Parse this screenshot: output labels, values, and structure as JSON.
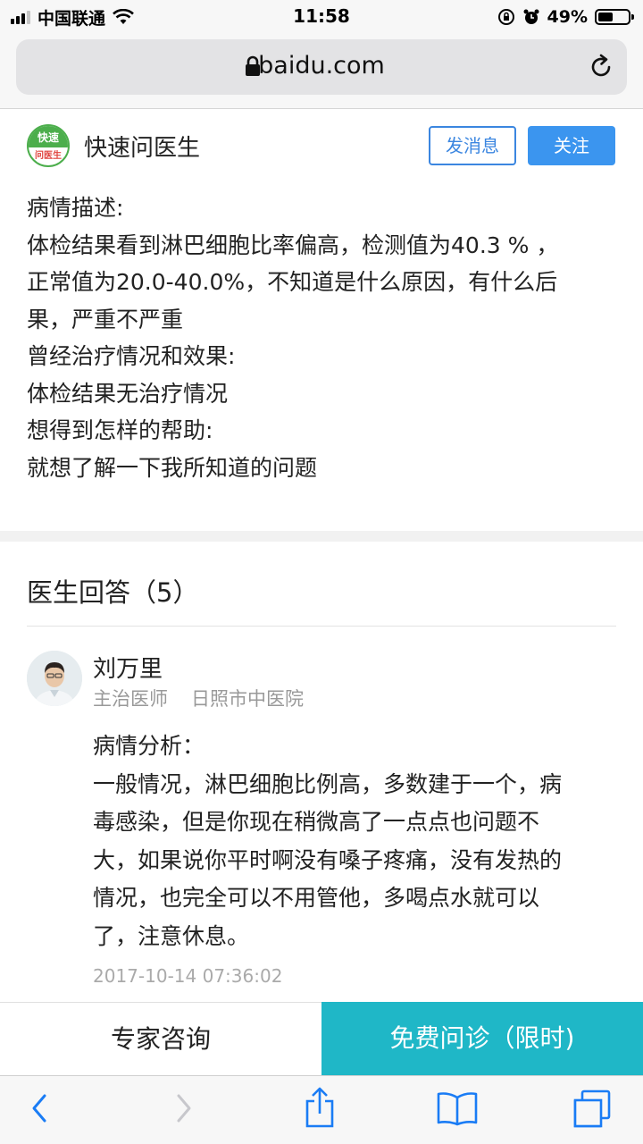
{
  "status_bar": {
    "carrier": "中国联通",
    "time": "11:58",
    "battery_text": "49%",
    "battery_level": 0.49
  },
  "browser": {
    "url": "baidu.com"
  },
  "site": {
    "logo_top": "快速",
    "logo_bottom": "问医生",
    "name": "快速问医生",
    "message_button": "发消息",
    "follow_button": "关注"
  },
  "question": {
    "lines": [
      "病情描述:",
      "体检结果看到淋巴细胞比率偏高，检测值为40.3 % ，",
      "正常值为20.0-40.0%，不知道是什么原因，有什么后",
      "果，严重不严重",
      "曾经治疗情况和效果:",
      "体检结果无治疗情况",
      "想得到怎样的帮助:",
      "就想了解一下我所知道的问题"
    ]
  },
  "answers": {
    "title": "医生回答（5）",
    "items": [
      {
        "doctor_name": "刘万里",
        "doctor_title": "主治医师",
        "hospital": "日照市中医院",
        "lines": [
          "病情分析：",
          "一般情况，淋巴细胞比例高，多数建于一个，病",
          "毒感染，但是你现在稍微高了一点点也问题不",
          "大，如果说你平时啊没有嗓子疼痛，没有发热的",
          "情况，也完全可以不用管他，多喝点水就可以",
          "了，注意休息。"
        ],
        "date": "2017-10-14 07:36:02"
      }
    ]
  },
  "action_bar": {
    "expert_label": "专家咨询",
    "free_label": "免费问诊（限时)"
  },
  "toolbar": {
    "icons": [
      "back-icon",
      "forward-icon",
      "share-icon",
      "bookmarks-icon",
      "tabs-icon"
    ]
  },
  "colors": {
    "accent_blue": "#3b95ef",
    "teal": "#1fb7c7",
    "logo_green": "#4cae4c"
  }
}
